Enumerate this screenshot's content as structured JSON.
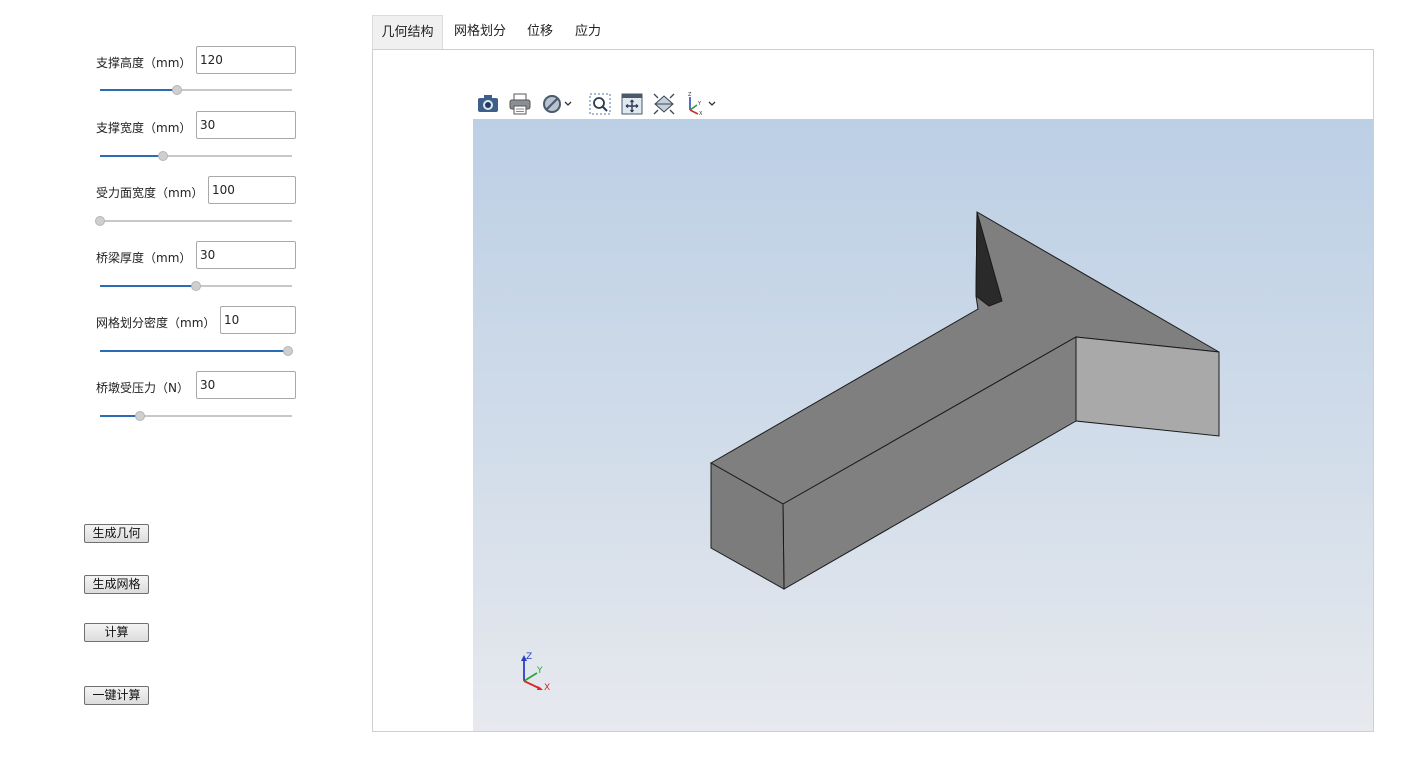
{
  "params": [
    {
      "label": "支撑高度（mm）",
      "value": "120",
      "slider": 0.4
    },
    {
      "label": "支撑宽度（mm）",
      "value": "30",
      "slider": 0.33
    },
    {
      "label": "受力面宽度（mm）",
      "value": "100",
      "slider": 0.0
    },
    {
      "label": "桥梁厚度（mm）",
      "value": "30",
      "slider": 0.5
    },
    {
      "label": "网格划分密度（mm）",
      "value": "10",
      "slider": 1.0
    },
    {
      "label": "桥墩受压力（N）",
      "value": "30",
      "slider": 0.21
    }
  ],
  "buttons": {
    "generate_geometry": "生成几何",
    "generate_mesh": "生成网格",
    "compute": "计算",
    "one_click_compute": "一键计算"
  },
  "tabs": [
    "几何结构",
    "网格划分",
    "位移",
    "应力"
  ],
  "active_tab": "几何结构",
  "toolbar_icons": [
    "camera-icon",
    "print-icon",
    "display-mode-icon",
    "chevron-down-icon",
    "zoom-box-icon",
    "fit-all-icon",
    "view-iso-icon",
    "axes-orientation-icon",
    "chevron-down-icon"
  ],
  "triad": {
    "x": "X",
    "y": "Y",
    "z": "Z"
  },
  "colors": {
    "accent": "#2d6bb3",
    "model_top": "#7f7f7f",
    "model_side": "#a9a9a9",
    "model_dark": "#2a2a2a"
  }
}
